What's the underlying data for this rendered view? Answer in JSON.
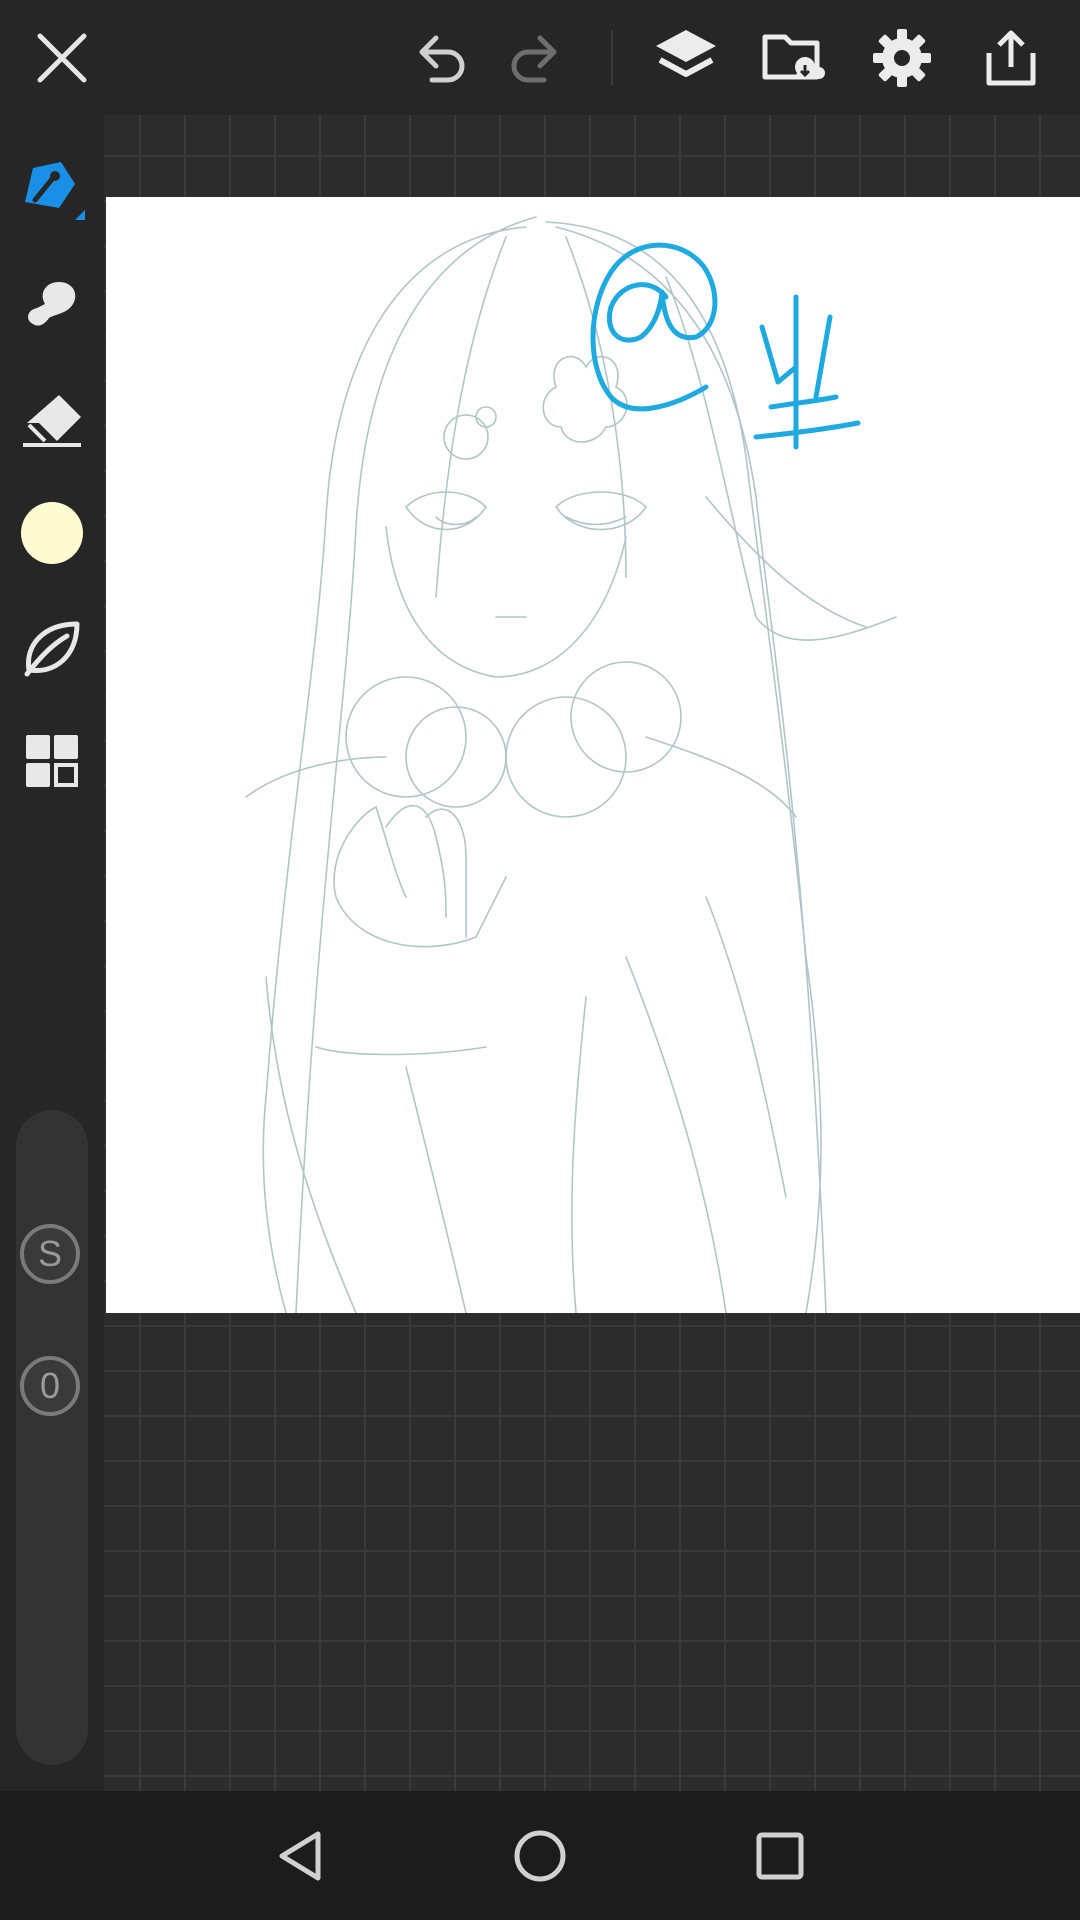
{
  "topbar": {
    "close": "close-icon",
    "undo": "undo-icon",
    "redo": "redo-icon",
    "layers": "layers-icon",
    "gallery": "folder-icon",
    "settings": "gear-icon",
    "export": "share-icon"
  },
  "toolbar": {
    "tools": [
      "pen-icon",
      "smudge-icon",
      "eraser-icon",
      "color-swatch",
      "leaf-icon",
      "grid-icon"
    ],
    "active_tool": "pen",
    "current_color": "#fffbd1"
  },
  "slider": {
    "size_label": "S",
    "opacity_label": "0"
  },
  "canvas": {
    "signature_color": "#1ea9e0",
    "sketch_color": "#9fb6b8"
  },
  "colors": {
    "accent": "#1a8fe6"
  },
  "navbar": {
    "back": "back-icon",
    "home": "home-icon",
    "recents": "recents-icon"
  }
}
